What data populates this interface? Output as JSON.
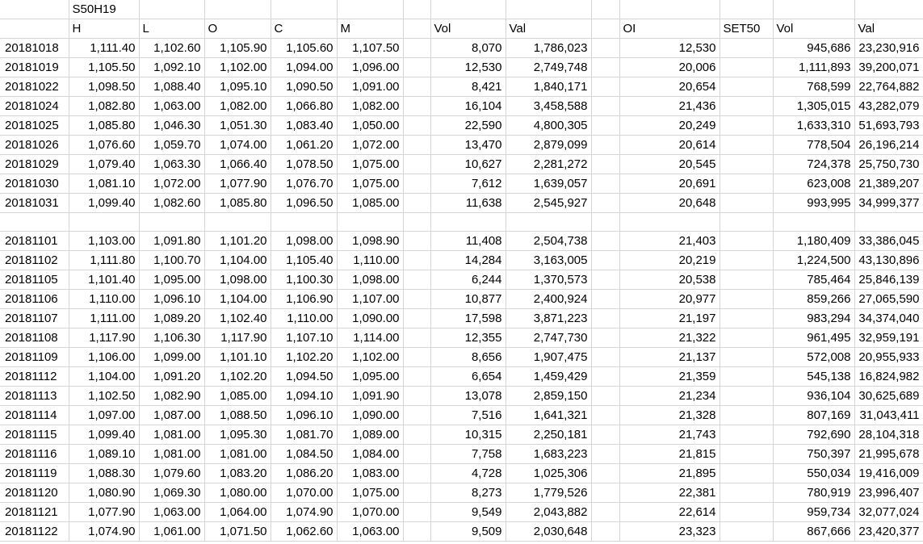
{
  "sheet": {
    "title_cell": "S50H19",
    "headers": [
      "",
      "H",
      "L",
      "O",
      "C",
      "M",
      "",
      "Vol",
      "Val",
      "",
      "OI",
      "SET50",
      "Vol",
      "Val"
    ],
    "block1": [
      [
        "20181018",
        "1,111.40",
        "1,102.60",
        "1,105.90",
        "1,105.60",
        "1,107.50",
        "",
        "8,070",
        "1,786,023",
        "",
        "12,530",
        "",
        "945,686",
        "23,230,916"
      ],
      [
        "20181019",
        "1,105.50",
        "1,092.10",
        "1,102.00",
        "1,094.00",
        "1,096.00",
        "",
        "12,530",
        "2,749,748",
        "",
        "20,006",
        "",
        "1,111,893",
        "39,200,071"
      ],
      [
        "20181022",
        "1,098.50",
        "1,088.40",
        "1,095.10",
        "1,090.50",
        "1,091.00",
        "",
        "8,421",
        "1,840,171",
        "",
        "20,654",
        "",
        "768,599",
        "22,764,882"
      ],
      [
        "20181024",
        "1,082.80",
        "1,063.00",
        "1,082.00",
        "1,066.80",
        "1,082.00",
        "",
        "16,104",
        "3,458,588",
        "",
        "21,436",
        "",
        "1,305,015",
        "43,282,079"
      ],
      [
        "20181025",
        "1,085.80",
        "1,046.30",
        "1,051.30",
        "1,083.40",
        "1,050.00",
        "",
        "22,590",
        "4,800,305",
        "",
        "20,249",
        "",
        "1,633,310",
        "51,693,793"
      ],
      [
        "20181026",
        "1,076.60",
        "1,059.70",
        "1,074.00",
        "1,061.20",
        "1,072.00",
        "",
        "13,470",
        "2,879,099",
        "",
        "20,614",
        "",
        "778,504",
        "26,196,214"
      ],
      [
        "20181029",
        "1,079.40",
        "1,063.30",
        "1,066.40",
        "1,078.50",
        "1,075.00",
        "",
        "10,627",
        "2,281,272",
        "",
        "20,545",
        "",
        "724,378",
        "25,750,730"
      ],
      [
        "20181030",
        "1,081.10",
        "1,072.00",
        "1,077.90",
        "1,076.70",
        "1,075.00",
        "",
        "7,612",
        "1,639,057",
        "",
        "20,691",
        "",
        "623,008",
        "21,389,207"
      ],
      [
        "20181031",
        "1,099.40",
        "1,082.60",
        "1,085.80",
        "1,096.50",
        "1,085.00",
        "",
        "11,638",
        "2,545,927",
        "",
        "20,648",
        "",
        "993,995",
        "34,999,377"
      ]
    ],
    "block2": [
      [
        "20181101",
        "1,103.00",
        "1,091.80",
        "1,101.20",
        "1,098.00",
        "1,098.90",
        "",
        "11,408",
        "2,504,738",
        "",
        "21,403",
        "",
        "1,180,409",
        "33,386,045"
      ],
      [
        "20181102",
        "1,111.80",
        "1,100.70",
        "1,104.00",
        "1,105.40",
        "1,110.00",
        "",
        "14,284",
        "3,163,005",
        "",
        "20,219",
        "",
        "1,224,500",
        "43,130,896"
      ],
      [
        "20181105",
        "1,101.40",
        "1,095.00",
        "1,098.00",
        "1,100.30",
        "1,098.00",
        "",
        "6,244",
        "1,370,573",
        "",
        "20,538",
        "",
        "785,464",
        "25,846,139"
      ],
      [
        "20181106",
        "1,110.00",
        "1,096.10",
        "1,104.00",
        "1,106.90",
        "1,107.00",
        "",
        "10,877",
        "2,400,924",
        "",
        "20,977",
        "",
        "859,266",
        "27,065,590"
      ],
      [
        "20181107",
        "1,111.00",
        "1,089.20",
        "1,102.40",
        "1,110.00",
        "1,090.00",
        "",
        "17,598",
        "3,871,223",
        "",
        "21,197",
        "",
        "983,294",
        "34,374,040"
      ],
      [
        "20181108",
        "1,117.90",
        "1,106.30",
        "1,117.90",
        "1,107.10",
        "1,114.00",
        "",
        "12,355",
        "2,747,730",
        "",
        "21,322",
        "",
        "961,495",
        "32,959,191"
      ],
      [
        "20181109",
        "1,106.00",
        "1,099.00",
        "1,101.10",
        "1,102.20",
        "1,102.00",
        "",
        "8,656",
        "1,907,475",
        "",
        "21,137",
        "",
        "572,008",
        "20,955,933"
      ],
      [
        "20181112",
        "1,104.00",
        "1,091.20",
        "1,102.20",
        "1,094.50",
        "1,095.00",
        "",
        "6,654",
        "1,459,429",
        "",
        "21,359",
        "",
        "545,138",
        "16,824,982"
      ],
      [
        "20181113",
        "1,102.50",
        "1,082.90",
        "1,085.00",
        "1,094.10",
        "1,091.90",
        "",
        "13,078",
        "2,859,150",
        "",
        "21,234",
        "",
        "936,104",
        "30,625,689"
      ],
      [
        "20181114",
        "1,097.00",
        "1,087.00",
        "1,088.50",
        "1,096.10",
        "1,090.00",
        "",
        "7,516",
        "1,641,321",
        "",
        "21,328",
        "",
        "807,169",
        "31,043,411"
      ],
      [
        "20181115",
        "1,099.40",
        "1,081.00",
        "1,095.30",
        "1,081.70",
        "1,089.00",
        "",
        "10,315",
        "2,250,181",
        "",
        "21,743",
        "",
        "792,690",
        "28,104,318"
      ],
      [
        "20181116",
        "1,089.10",
        "1,081.00",
        "1,081.00",
        "1,084.50",
        "1,084.00",
        "",
        "7,758",
        "1,683,223",
        "",
        "21,815",
        "",
        "750,397",
        "21,995,678"
      ],
      [
        "20181119",
        "1,088.30",
        "1,079.60",
        "1,083.20",
        "1,086.20",
        "1,083.00",
        "",
        "4,728",
        "1,025,306",
        "",
        "21,895",
        "",
        "550,034",
        "19,416,009"
      ],
      [
        "20181120",
        "1,080.90",
        "1,069.30",
        "1,080.00",
        "1,070.00",
        "1,075.00",
        "",
        "8,273",
        "1,779,526",
        "",
        "22,381",
        "",
        "780,919",
        "23,996,407"
      ],
      [
        "20181121",
        "1,077.90",
        "1,063.00",
        "1,064.00",
        "1,074.90",
        "1,070.00",
        "",
        "9,549",
        "2,043,882",
        "",
        "22,614",
        "",
        "959,734",
        "32,077,024"
      ],
      [
        "20181122",
        "1,074.90",
        "1,061.00",
        "1,071.50",
        "1,062.60",
        "1,063.00",
        "",
        "9,509",
        "2,030,648",
        "",
        "23,323",
        "",
        "867,666",
        "23,420,377"
      ]
    ]
  }
}
